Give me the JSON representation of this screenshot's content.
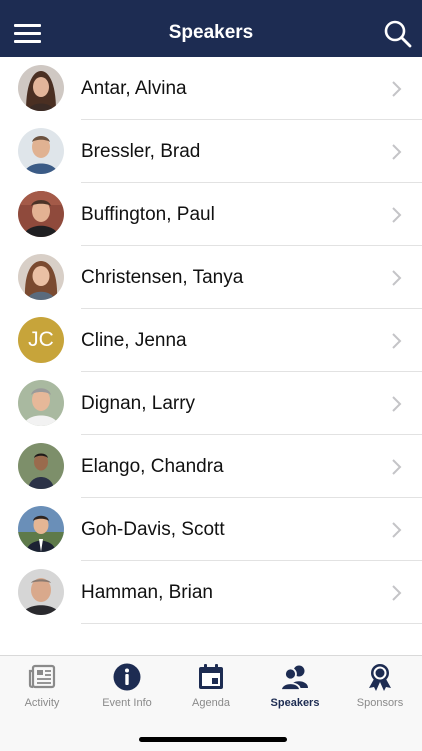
{
  "header": {
    "title": "Speakers"
  },
  "icons": {
    "menu": "menu-icon",
    "search": "search-icon",
    "chevron": "chevron-right-icon"
  },
  "colors": {
    "header_bg": "#1d2c52",
    "initials_bg": "#c7a43a",
    "tab_active": "#1d2c52",
    "tab_inactive": "#8a8a8a"
  },
  "speakers": [
    {
      "name": "Antar, Alvina"
    },
    {
      "name": "Bressler, Brad"
    },
    {
      "name": "Buffington, Paul"
    },
    {
      "name": "Christensen, Tanya"
    },
    {
      "name": "Cline, Jenna",
      "initials": "JC"
    },
    {
      "name": "Dignan, Larry"
    },
    {
      "name": "Elango, Chandra"
    },
    {
      "name": "Goh-Davis, Scott"
    },
    {
      "name": "Hamman, Brian"
    }
  ],
  "tabs": [
    {
      "label": "Activity",
      "icon": "newspaper-icon"
    },
    {
      "label": "Event Info",
      "icon": "info-icon"
    },
    {
      "label": "Agenda",
      "icon": "calendar-icon"
    },
    {
      "label": "Speakers",
      "icon": "people-icon",
      "active": true
    },
    {
      "label": "Sponsors",
      "icon": "award-ribbon-icon"
    }
  ]
}
